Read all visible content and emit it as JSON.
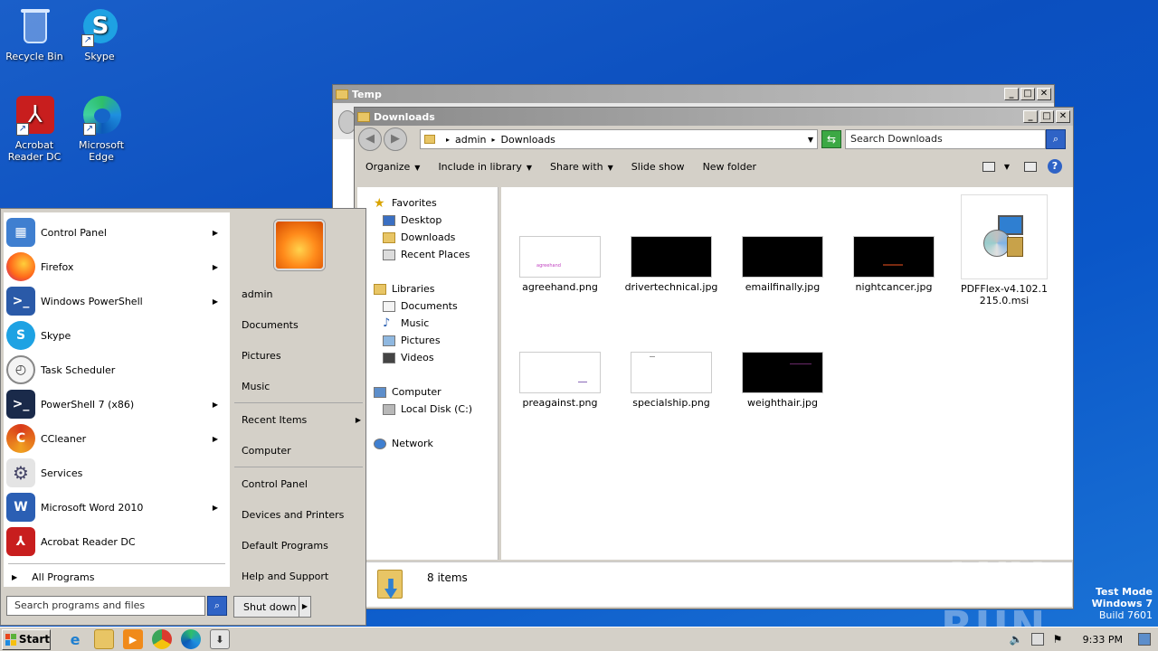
{
  "desktop": {
    "icons": [
      {
        "label": "Recycle Bin",
        "icon": "recycle-bin-icon"
      },
      {
        "label": "Skype",
        "icon": "skype-icon"
      },
      {
        "label": "Acrobat Reader DC",
        "icon": "acrobat-icon"
      },
      {
        "label": "Microsoft Edge",
        "icon": "edge-icon"
      }
    ]
  },
  "temp_window": {
    "title": "Temp"
  },
  "downloads_window": {
    "title": "Downloads",
    "breadcrumb": [
      "admin",
      "Downloads"
    ],
    "search_placeholder": "Search Downloads",
    "commands": {
      "organize": "Organize",
      "include_in_library": "Include in library",
      "share_with": "Share with",
      "slide_show": "Slide show",
      "new_folder": "New folder"
    },
    "nav": {
      "favorites": "Favorites",
      "desktop": "Desktop",
      "downloads": "Downloads",
      "recent_places": "Recent Places",
      "libraries": "Libraries",
      "documents": "Documents",
      "music": "Music",
      "pictures": "Pictures",
      "videos": "Videos",
      "computer": "Computer",
      "local_disk": "Local Disk (C:)",
      "network": "Network"
    },
    "files": [
      {
        "name": "agreehand.png",
        "thumb": "white",
        "caption": "agreehand"
      },
      {
        "name": "drivertechnical.jpg",
        "thumb": "black",
        "caption": ""
      },
      {
        "name": "emailfinally.jpg",
        "thumb": "black",
        "caption": ""
      },
      {
        "name": "nightcancer.jpg",
        "thumb": "black",
        "caption": ""
      },
      {
        "name": "PDFFlex-v4.102.1215.0.msi",
        "thumb": "installer",
        "caption": ""
      },
      {
        "name": "preagainst.png",
        "thumb": "white",
        "caption": ""
      },
      {
        "name": "specialship.png",
        "thumb": "white",
        "caption": ""
      },
      {
        "name": "weighthair.jpg",
        "thumb": "black",
        "caption": ""
      }
    ],
    "status": "8 items"
  },
  "start_menu": {
    "programs": [
      {
        "label": "Control Panel",
        "icon": "control-panel-icon",
        "has_arrow": true
      },
      {
        "label": "Firefox",
        "icon": "firefox-icon",
        "has_arrow": true
      },
      {
        "label": "Windows PowerShell",
        "icon": "powershell-icon",
        "has_arrow": true
      },
      {
        "label": "Skype",
        "icon": "skype-icon",
        "has_arrow": false
      },
      {
        "label": "Task Scheduler",
        "icon": "task-scheduler-icon",
        "has_arrow": false
      },
      {
        "label": "PowerShell 7 (x86)",
        "icon": "powershell7-icon",
        "has_arrow": true
      },
      {
        "label": "CCleaner",
        "icon": "ccleaner-icon",
        "has_arrow": true
      },
      {
        "label": "Services",
        "icon": "services-icon",
        "has_arrow": false
      },
      {
        "label": "Microsoft Word 2010",
        "icon": "word-icon",
        "has_arrow": true
      },
      {
        "label": "Acrobat Reader DC",
        "icon": "acrobat-icon",
        "has_arrow": false
      }
    ],
    "all_programs": "All Programs",
    "right": {
      "user": "admin",
      "documents": "Documents",
      "pictures": "Pictures",
      "music": "Music",
      "recent_items": "Recent Items",
      "computer": "Computer",
      "control_panel": "Control Panel",
      "devices_printers": "Devices and Printers",
      "default_programs": "Default Programs",
      "help_support": "Help and Support"
    },
    "search_placeholder": "Search programs and files",
    "shutdown": "Shut down"
  },
  "taskbar": {
    "start": "Start",
    "clock": "9:33 PM"
  },
  "watermark": {
    "line1": "Test Mode",
    "line2": "Windows 7",
    "line3": "Build 7601",
    "brand": "ANY RUN"
  }
}
